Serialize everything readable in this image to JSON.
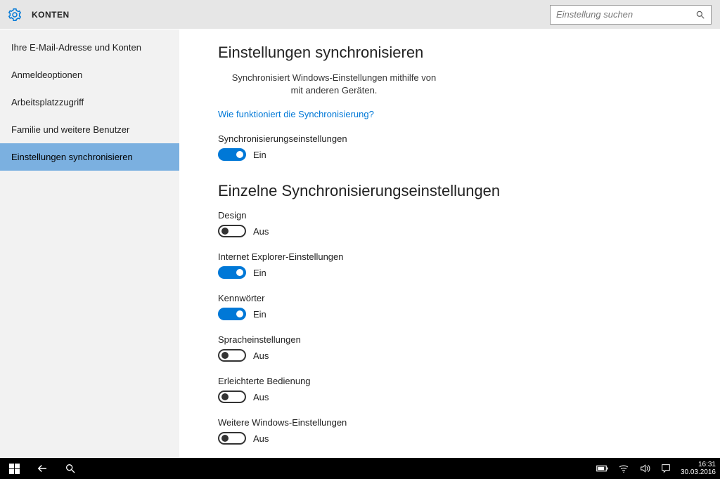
{
  "header": {
    "title": "KONTEN",
    "search_placeholder": "Einstellung suchen"
  },
  "sidebar": {
    "items": [
      {
        "label": "Ihre E-Mail-Adresse und Konten",
        "selected": false
      },
      {
        "label": "Anmeldeoptionen",
        "selected": false
      },
      {
        "label": "Arbeitsplatzzugriff",
        "selected": false
      },
      {
        "label": "Familie und weitere Benutzer",
        "selected": false
      },
      {
        "label": "Einstellungen synchronisieren",
        "selected": true
      }
    ]
  },
  "main": {
    "heading1": "Einstellungen synchronisieren",
    "description_line1": "Synchronisiert Windows-Einstellungen mithilfe von",
    "description_line2": "mit anderen Geräten.",
    "help_link": "Wie funktioniert die Synchronisierung?",
    "master_toggle": {
      "label": "Synchronisierungseinstellungen",
      "on": true
    },
    "heading2": "Einzelne Synchronisierungseinstellungen",
    "toggles": [
      {
        "label": "Design",
        "on": false
      },
      {
        "label": "Internet Explorer-Einstellungen",
        "on": true
      },
      {
        "label": "Kennwörter",
        "on": true
      },
      {
        "label": "Spracheinstellungen",
        "on": false
      },
      {
        "label": "Erleichterte Bedienung",
        "on": false
      },
      {
        "label": "Weitere Windows-Einstellungen",
        "on": false
      }
    ],
    "state_labels": {
      "on": "Ein",
      "off": "Aus"
    }
  },
  "taskbar": {
    "time": "16:31",
    "date": "30.03.2016"
  }
}
